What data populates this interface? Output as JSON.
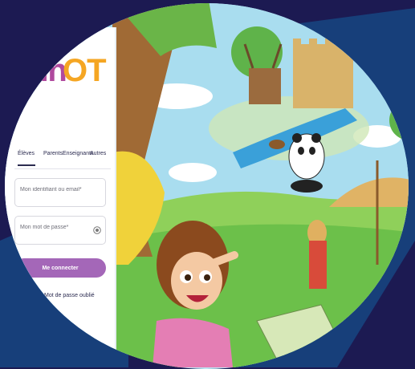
{
  "login": {
    "logo_part1": "nn",
    "logo_part2": "OT",
    "tabs": [
      "Élèves",
      "Parents",
      "Enseignants",
      "Autres"
    ],
    "active_tab": "Élèves",
    "username_placeholder": "Mon identifiant ou email*",
    "password_placeholder": "Mon mot de passe*",
    "submit_label": "Me connecter",
    "forgot_password": "Mot de passe oublié"
  },
  "colors": {
    "background_dark": "#1c1a52",
    "background_blue": "#173f7a",
    "button": "#a467b8",
    "logo_purple": "#b04a9e",
    "logo_orange": "#f5a623"
  }
}
